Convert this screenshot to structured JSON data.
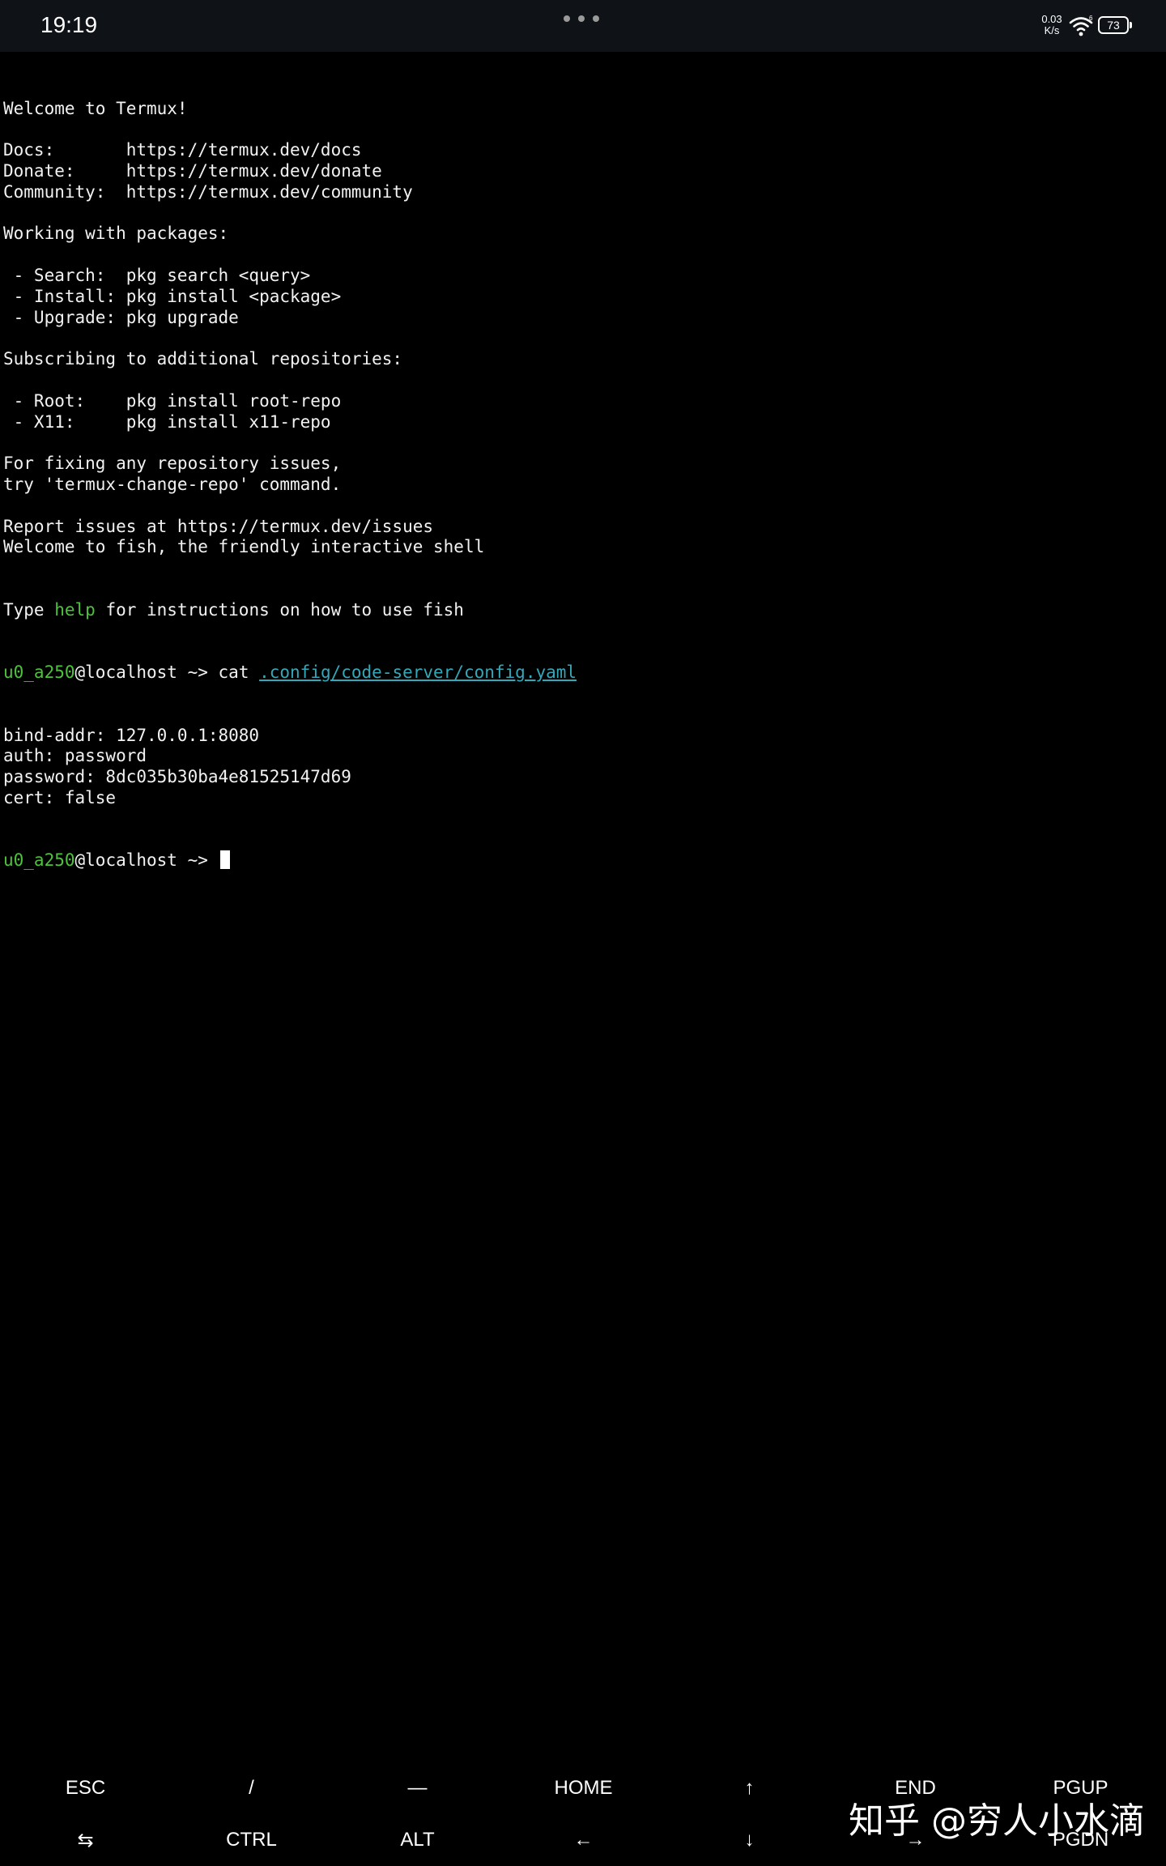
{
  "status_bar": {
    "time": "19:19",
    "net_speed_value": "0.03",
    "net_speed_unit": "K/s",
    "wifi_label": "6",
    "battery": "73",
    "icons": [
      "more-dots-icon",
      "wifi-icon",
      "battery-icon"
    ]
  },
  "terminal": {
    "lines": [
      "Welcome to Termux!",
      "",
      "Docs:       https://termux.dev/docs",
      "Donate:     https://termux.dev/donate",
      "Community:  https://termux.dev/community",
      "",
      "Working with packages:",
      "",
      " - Search:  pkg search <query>",
      " - Install: pkg install <package>",
      " - Upgrade: pkg upgrade",
      "",
      "Subscribing to additional repositories:",
      "",
      " - Root:    pkg install root-repo",
      " - X11:     pkg install x11-repo",
      "",
      "For fixing any repository issues,",
      "try 'termux-change-repo' command.",
      "",
      "Report issues at https://termux.dev/issues",
      "Welcome to fish, the friendly interactive shell"
    ],
    "help_line": {
      "before": "Type ",
      "highlight": "help",
      "after": " for instructions on how to use fish"
    },
    "prompt_user": "u0_a250",
    "prompt_host": "@localhost ~> ",
    "command": "cat ",
    "command_path": ".config/code-server/config.yaml",
    "output": [
      "bind-addr: 127.0.0.1:8080",
      "auth: password",
      "password: 8dc035b30ba4e81525147d69",
      "cert: false"
    ],
    "prompt2_user": "u0_a250",
    "prompt2_host": "@localhost ~> "
  },
  "extra_keys": {
    "row1": [
      "ESC",
      "/",
      "—",
      "HOME",
      "↑",
      "END",
      "PGUP"
    ],
    "row2": [
      "⇆",
      "CTRL",
      "ALT",
      "←",
      "↓",
      "→",
      "PGDN"
    ]
  },
  "watermark": "知乎 @穷人小水滴",
  "colors": {
    "background": "#000000",
    "status_bar": "#0f1216",
    "prompt_green": "#4ec23c",
    "path_cyan": "#33a8b8",
    "text": "#f2f2f2"
  }
}
